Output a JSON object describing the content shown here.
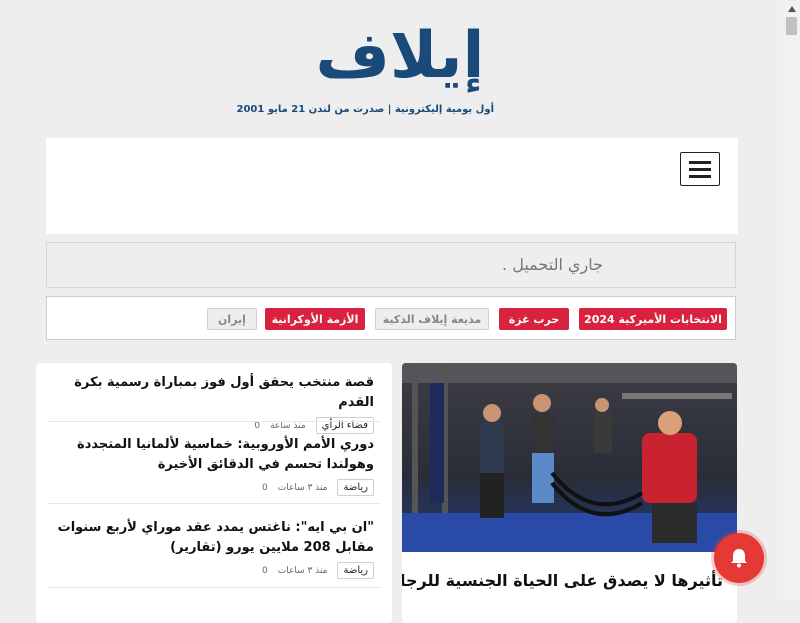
{
  "brand": {
    "logo": "إيلاف",
    "tagline": "أول يومية إليكترونية | صدرت من لندن 21 مايو 2001"
  },
  "loading": {
    "text": "جاري التحميل ."
  },
  "tags": [
    {
      "label": "الانتخابات الأميركية 2024",
      "style": "red"
    },
    {
      "label": "حرب غزة",
      "style": "red"
    },
    {
      "label": "مذيعة إيلاف الذكية",
      "style": "grey"
    },
    {
      "label": "الأزمة الأوكرانية",
      "style": "red"
    },
    {
      "label": "إيران",
      "style": "grey"
    }
  ],
  "news": [
    {
      "title": "قصة منتخب يحقق أول فوز بمباراة رسمية بكرة القدم",
      "category": "فضاء الرأي",
      "time": "منذ ساعة",
      "comments": "0"
    },
    {
      "title": "دوري الأمم الأوروبية: خماسية لألمانيا المتجددة وهولندا تحسم في الدقائق الأخيرة",
      "category": "رياضة",
      "time": "منذ ٣ ساعات",
      "comments": "0"
    },
    {
      "title": "\"ان بي ايه\": ناغتس يمدد عقد موراي لأربع سنوات مقابل 208 ملايين يورو (تقارير)",
      "category": "رياضة",
      "time": "منذ ٣ ساعات",
      "comments": "0"
    }
  ],
  "featured": {
    "title": "تأثيرها لا يصدق على الحياة الجنسية للرجال"
  },
  "colors": {
    "brand_blue": "#1a4a7a",
    "tag_red": "#d9223f",
    "bell_red": "#e53935"
  },
  "icons": {
    "menu": "hamburger-icon",
    "bell": "bell-icon",
    "scroll": "scroll-up-arrow-icon"
  }
}
